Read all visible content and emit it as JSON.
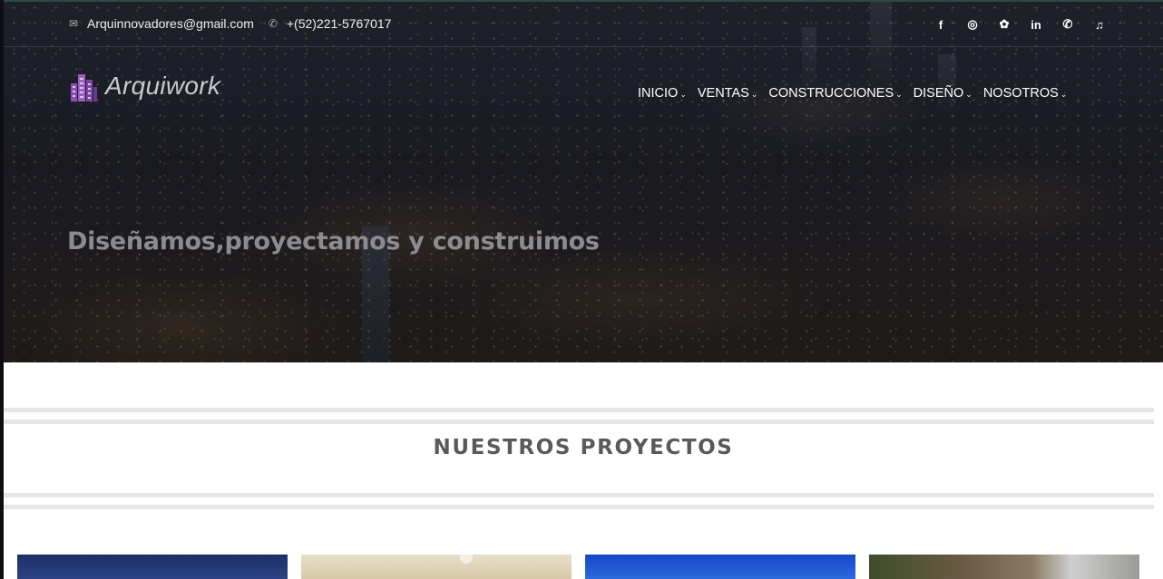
{
  "topbar": {
    "email": "Arquinnovadores@gmail.com",
    "phone": "+(52)221-5767017",
    "social": [
      {
        "name": "facebook-icon",
        "glyph": "f"
      },
      {
        "name": "instagram-icon",
        "glyph": "◎"
      },
      {
        "name": "twitter-icon",
        "glyph": "✿"
      },
      {
        "name": "linkedin-icon",
        "glyph": "in"
      },
      {
        "name": "whatsapp-icon",
        "glyph": "✆"
      },
      {
        "name": "tiktok-icon",
        "glyph": "♫"
      }
    ]
  },
  "logo": {
    "text": "Arquiwork",
    "color": "#9b5fc0"
  },
  "nav": {
    "items": [
      {
        "label": "INICIO"
      },
      {
        "label": "VENTAS"
      },
      {
        "label": "CONSTRUCCIONES"
      },
      {
        "label": "DISEÑO"
      },
      {
        "label": "NOSOTROS"
      }
    ],
    "chevron": "⌄"
  },
  "hero": {
    "headline": "Diseñamos,proyectamos y construimos"
  },
  "projects": {
    "title": "NUESTROS PROYECTOS"
  },
  "icons": {
    "email": "✉",
    "phone": "✆"
  }
}
